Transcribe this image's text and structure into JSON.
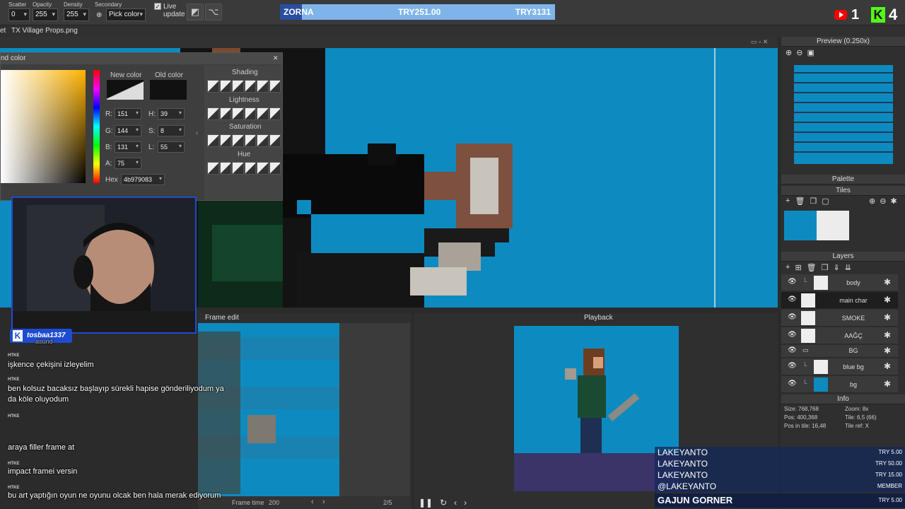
{
  "toolbar": {
    "scatter": {
      "label": "Scatter",
      "value": "0"
    },
    "opacity": {
      "label": "Opacity",
      "value": "255"
    },
    "density": {
      "label": "Density",
      "value": "255"
    },
    "secondary": {
      "label": "Secondary",
      "value": "Pick color"
    },
    "live_update": "Live update"
  },
  "donation": {
    "name": "ZORNA",
    "current": "TRY251.00",
    "goal": "TRY3131",
    "progress": 0.08
  },
  "stream_badges": {
    "youtube_count": "1",
    "kick_count": "4"
  },
  "tab": {
    "file": "TX Village Props.png",
    "prefix": "et"
  },
  "color_dialog": {
    "title": "nd color",
    "new_color": "New color",
    "old_color": "Old color",
    "r": "151",
    "g": "144",
    "b": "131",
    "a": "75",
    "h": "39",
    "s": "8",
    "l": "55",
    "hex_label": "Hex",
    "hex": "4b979083",
    "shading": "Shading",
    "lightness": "Lightness",
    "saturation": "Saturation",
    "hue": "Hue"
  },
  "preview": {
    "title": "Preview (0.250x)"
  },
  "palette": {
    "title": "Palette"
  },
  "tiles": {
    "title": "Tiles"
  },
  "layers": {
    "title": "Layers",
    "items": [
      {
        "name": "body"
      },
      {
        "name": "main char"
      },
      {
        "name": "SMOKE"
      },
      {
        "name": "AAĞÇ"
      },
      {
        "name": "BG"
      },
      {
        "name": "blue bg"
      },
      {
        "name": "bg"
      }
    ]
  },
  "info": {
    "title": "Info",
    "size": "Size: 768,768",
    "pos": "Pos: 400,368",
    "pos_tile": "Pos in tile: 16,48",
    "zoom": "Zoom: 8x",
    "tile": "Tile: 6,5 (66)",
    "tile_ref": "Tile ref: X"
  },
  "frame_edit": {
    "title": "Frame edit",
    "frame_time_label": "Frame time",
    "frame_time": "200",
    "page": "2/5"
  },
  "playback": {
    "title": "Playback"
  },
  "chat": {
    "user": "tosbaa1337",
    "partial": "asund",
    "messages": [
      "işkence çekişini izleyelim",
      "ben kolsuz bacaksız başlayıp sürekli hapise gönderiliyodum ya da köle oluyodum",
      "araya filler frame at",
      "impact framei versin",
      "bu art yaptığın oyun ne oyunu olcak ben hala merak ediyorum"
    ]
  },
  "donors": [
    {
      "name": "LAKEYANTO",
      "amount": "TRY 5.00"
    },
    {
      "name": "LAKEYANTO",
      "amount": "TRY 50.00"
    },
    {
      "name": "LAKEYANTO",
      "amount": "TRY 15.00"
    },
    {
      "name": "@LAKEYANTO",
      "amount": "MEMBER"
    },
    {
      "name": "GAJUN GORNER",
      "amount": "TRY 5.00"
    }
  ],
  "colors": {
    "canvas_bg": "#0d8bc0",
    "accent_blue": "#1e4cd0",
    "kick_green": "#53fc18",
    "youtube_red": "#ff0000"
  }
}
